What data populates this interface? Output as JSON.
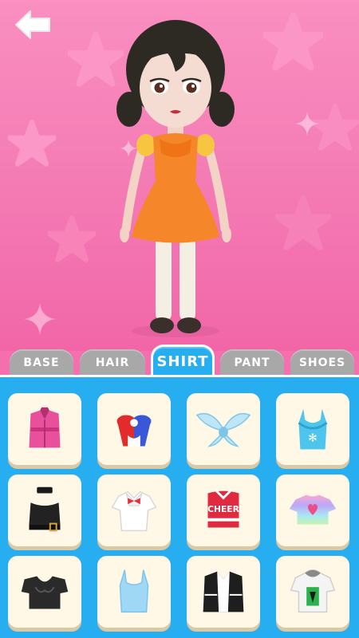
{
  "header": {
    "back_icon": "back-arrow-icon"
  },
  "tabs": [
    {
      "label": "BASE",
      "active": false
    },
    {
      "label": "HAIR",
      "active": false
    },
    {
      "label": "SHIRT",
      "active": true
    },
    {
      "label": "PANT",
      "active": false
    },
    {
      "label": "SHOES",
      "active": false
    }
  ],
  "items": [
    {
      "name": "pink-western-vest-icon"
    },
    {
      "name": "red-blue-bow-top-icon"
    },
    {
      "name": "fairy-wing-top-icon"
    },
    {
      "name": "blue-snowflake-cami-icon"
    },
    {
      "name": "black-belt-crop-top-icon"
    },
    {
      "name": "white-sailor-shirt-icon"
    },
    {
      "name": "cheer-crop-top-icon",
      "text": "CHEER"
    },
    {
      "name": "rainbow-heart-crop-tee-icon"
    },
    {
      "name": "black-sweetheart-top-icon"
    },
    {
      "name": "light-blue-cami-icon"
    },
    {
      "name": "black-vest-white-shirt-icon"
    },
    {
      "name": "hoodie-green-print-tee-icon"
    }
  ],
  "colors": {
    "background_pink": "#f47cb5",
    "panel_blue": "#27aef0",
    "card_bg": "#fff8e6",
    "tab_inactive": "#a8a8a8"
  }
}
